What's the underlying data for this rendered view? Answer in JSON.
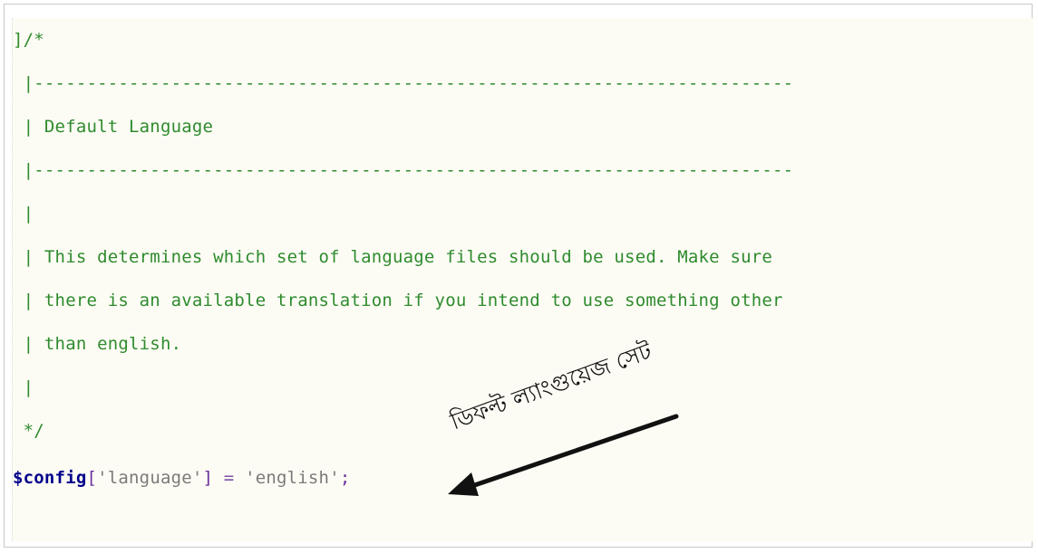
{
  "code": {
    "lines": [
      {
        "text": "]/*",
        "kind": "comment"
      },
      {
        "text": " |------------------------------------------------------------------------",
        "kind": "comment"
      },
      {
        "text": " | Default Language",
        "kind": "comment"
      },
      {
        "text": " |------------------------------------------------------------------------",
        "kind": "comment"
      },
      {
        "text": " |",
        "kind": "comment"
      },
      {
        "text": " | This determines which set of language files should be used. Make sure",
        "kind": "comment"
      },
      {
        "text": " | there is an available translation if you intend to use something other",
        "kind": "comment"
      },
      {
        "text": " | than english.",
        "kind": "comment"
      },
      {
        "text": " |",
        "kind": "comment"
      },
      {
        "text": " */",
        "kind": "comment"
      }
    ],
    "config_line": {
      "var": "$config",
      "open_bracket": "[",
      "key": "'language'",
      "close_bracket": "]",
      "assign": " = ",
      "value": "'english'",
      "semicolon": ";"
    }
  },
  "annotation": {
    "label": "ডিফল্ট ল্যাংগুয়েজ সেট"
  },
  "colors": {
    "comment": "#2e8b2e",
    "variable": "#00008b",
    "bracket": "#6b2fa0",
    "string": "#7a7a7a",
    "background": "#fdfcf4"
  }
}
